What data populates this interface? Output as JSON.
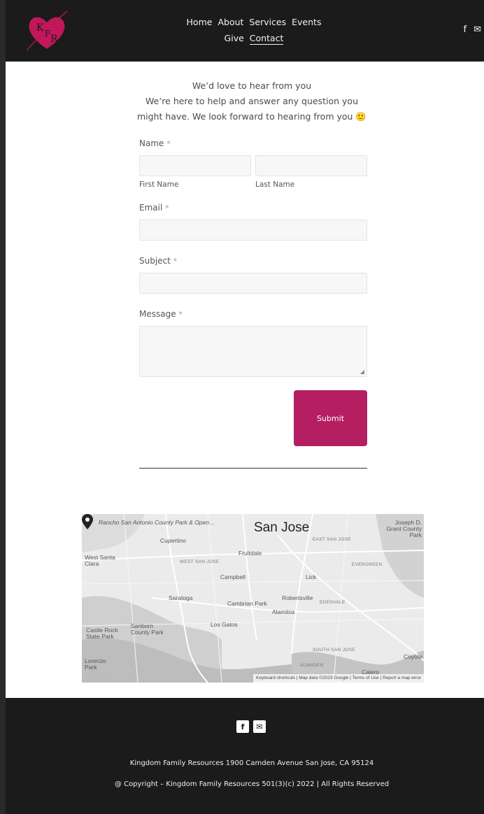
{
  "brand": {
    "logo_letters": "K F R",
    "accent": "#b51f62"
  },
  "nav": {
    "row1": [
      "Home",
      "About",
      "Services",
      "Events"
    ],
    "row2": [
      "Give",
      "Contact"
    ],
    "active": "Contact"
  },
  "social": {
    "facebook_icon": "f",
    "email_icon": "✉"
  },
  "intro": {
    "heading": "We’d love to hear from you",
    "body": "We’re here to help and answer any question you might have. We look forward to hearing from you 🙂"
  },
  "form": {
    "name_label": "Name",
    "required_mark": "*",
    "first_name_label": "First Name",
    "last_name_label": "Last Name",
    "email_label": "Email",
    "subject_label": "Subject",
    "message_label": "Message",
    "submit_label": "Submit"
  },
  "map": {
    "city": "San Jose",
    "labels": {
      "rancho": "Rancho San Antonio County Park & Open…",
      "cupertino": "Cupertino",
      "west_santa_clara": "West Santa Clara",
      "west_san_jose": "WEST SAN JOSE",
      "fruitdale": "Fruitdale",
      "east_san_jose": "EAST SAN JOSE",
      "joseph_grant": "Joseph D. Grant County Park",
      "evergreen": "EVERGREEN",
      "campbell": "Campbell",
      "lick": "Lick",
      "saratoga": "Saratoga",
      "cambrian": "Cambrian Park",
      "robertsville": "Robertsville",
      "edenvale": "EDENVALE",
      "alamitos": "Alamitos",
      "los_gatos": "Los Gatos",
      "castle_rock": "Castle Rock State Park",
      "sanborn": "Sanborn County Park",
      "south_san_jose": "SOUTH SAN JOSE",
      "almaden": "ALMADEN",
      "coyote": "Coyote",
      "lorenzo": "Lorenzo Park",
      "calero": "Calero"
    },
    "google": "Google",
    "footer_links": [
      "Keyboard shortcuts",
      "Map data ©2023 Google",
      "Terms of Use",
      "Report a map error"
    ]
  },
  "footer": {
    "address": "Kingdom Family Resources 1900 Camden Avenue San Jose, CA 95124",
    "copyright": "@ Copyright – Kingdom Family Resources 501(3)(c) 2022 | All Rights Reserved"
  }
}
